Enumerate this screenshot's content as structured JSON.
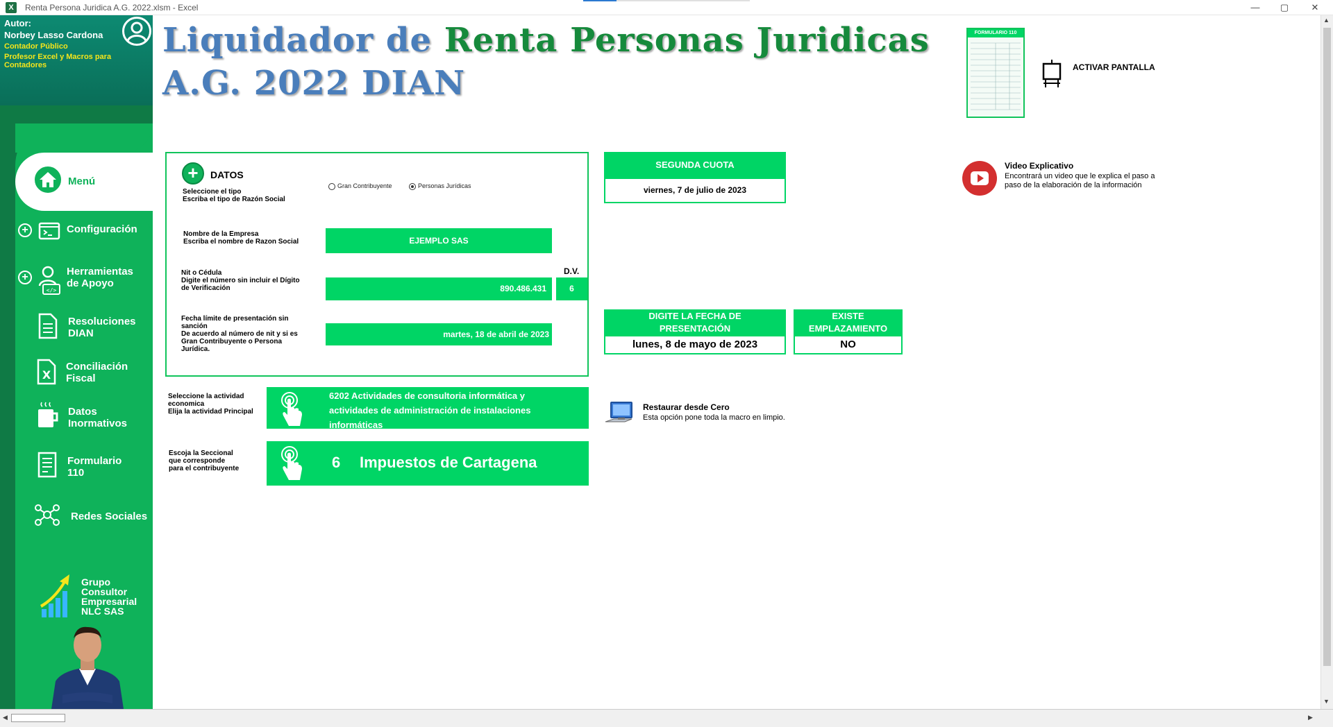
{
  "window": {
    "title": "Renta Persona Juridica A.G. 2022.xlsm - Excel",
    "app_icon": "excel-icon",
    "controls": [
      "—",
      "▢",
      "✕"
    ]
  },
  "sidebar": {
    "author_label": "Autor:",
    "author_name": "Norbey Lasso Cardona",
    "author_title_1": "Contador Público",
    "author_title_2": "Profesor Excel y Macros para",
    "author_title_3": "Contadores",
    "items": [
      {
        "label": "Menú",
        "icon": "home-icon"
      },
      {
        "label": "Configuración",
        "icon": "console-icon"
      },
      {
        "label_1": "Herramientas",
        "label_2": "de Apoyo",
        "icon": "developer-icon"
      },
      {
        "label_1": "Resoluciones",
        "label_2": "DIAN",
        "icon": "document-icon"
      },
      {
        "label_1": "Conciliación",
        "label_2": "Fiscal",
        "icon": "excel-file-icon"
      },
      {
        "label_1": "Datos",
        "label_2": "Inormativos",
        "icon": "coffee-icon"
      },
      {
        "label_1": "Formulario",
        "label_2": "110",
        "icon": "form-icon"
      },
      {
        "label": "Redes Sociales",
        "icon": "network-icon"
      }
    ],
    "company_1": "Grupo",
    "company_2": "Consultor",
    "company_3": "Empresarial",
    "company_4": "NLC SAS"
  },
  "header": {
    "title_part1": "Liquidador de",
    "title_part2": "Renta Personas Juridicas",
    "title_line2": "A.G.  2022 DIAN"
  },
  "form_thumb": {
    "label": "FORMULARIO 110"
  },
  "activar": {
    "label": "ACTIVAR PANTALLA"
  },
  "datos": {
    "heading": "DATOS",
    "tipo_label_1": "Seleccione el tipo",
    "tipo_label_2": "Escriba el tipo de Razón Social",
    "radio_options": [
      "Gran Contribuyente",
      "Personas Jurídicas"
    ],
    "radio_selected": 1,
    "empresa_label_1": "Nombre de la Empresa",
    "empresa_label_2": "Escriba el nombre de Razon Social",
    "empresa_value": "EJEMPLO SAS",
    "nit_label_1": "Nit o Cédula",
    "nit_label_2": "Digite el número sin incluir el Dígito",
    "nit_label_3": "de Verificación",
    "nit_value": "890.486.431",
    "dv_label": "D.V.",
    "dv_value": "6",
    "fecha_label_1": "Fecha límite de presentación sin",
    "fecha_label_2": "sanción",
    "fecha_label_3": "De acuerdo al número de nit y si es",
    "fecha_label_4": "Gran Contribuyente o Persona",
    "fecha_label_5": "Jurídica.",
    "fecha_value": "martes, 18 de abril de 2023"
  },
  "segunda_cuota": {
    "header": "SEGUNDA CUOTA",
    "value": "viernes, 7 de julio de 2023"
  },
  "video": {
    "title": "Video Explicativo",
    "desc_1": "Encontrará un video que le explica el paso a",
    "desc_2": "paso de la elaboración de la información"
  },
  "presentacion": {
    "header_1": "DIGITE LA FECHA DE",
    "header_2": "PRESENTACIÓN",
    "value": "lunes, 8 de mayo de 2023"
  },
  "emplazamiento": {
    "header_1": "EXISTE",
    "header_2": "EMPLAZAMIENTO",
    "value": "NO"
  },
  "actividad": {
    "label_1": "Seleccione la actividad",
    "label_2": "economica",
    "label_3": "Elija la actividad Principal",
    "value_1": "6202 Actividades de consultoria informática y",
    "value_2": "actividades de administración de instalaciones",
    "value_3": "informáticas"
  },
  "restaurar": {
    "title": "Restaurar desde Cero",
    "desc": "Esta opción pone toda la macro en limpio."
  },
  "seccional": {
    "label_1": "Escoja la Seccional",
    "label_2": "que corresponde",
    "label_3": "para el contribuyente",
    "code": "6",
    "value": "Impuestos de Cartagena"
  },
  "colors": {
    "sidebar_dark": "#0f7a45",
    "sidebar_green": "#0fb25a",
    "accent_green": "#00d565",
    "title_blue": "#4a7ebb",
    "title_green": "#168a3c",
    "youtube_red": "#d32f2f"
  }
}
